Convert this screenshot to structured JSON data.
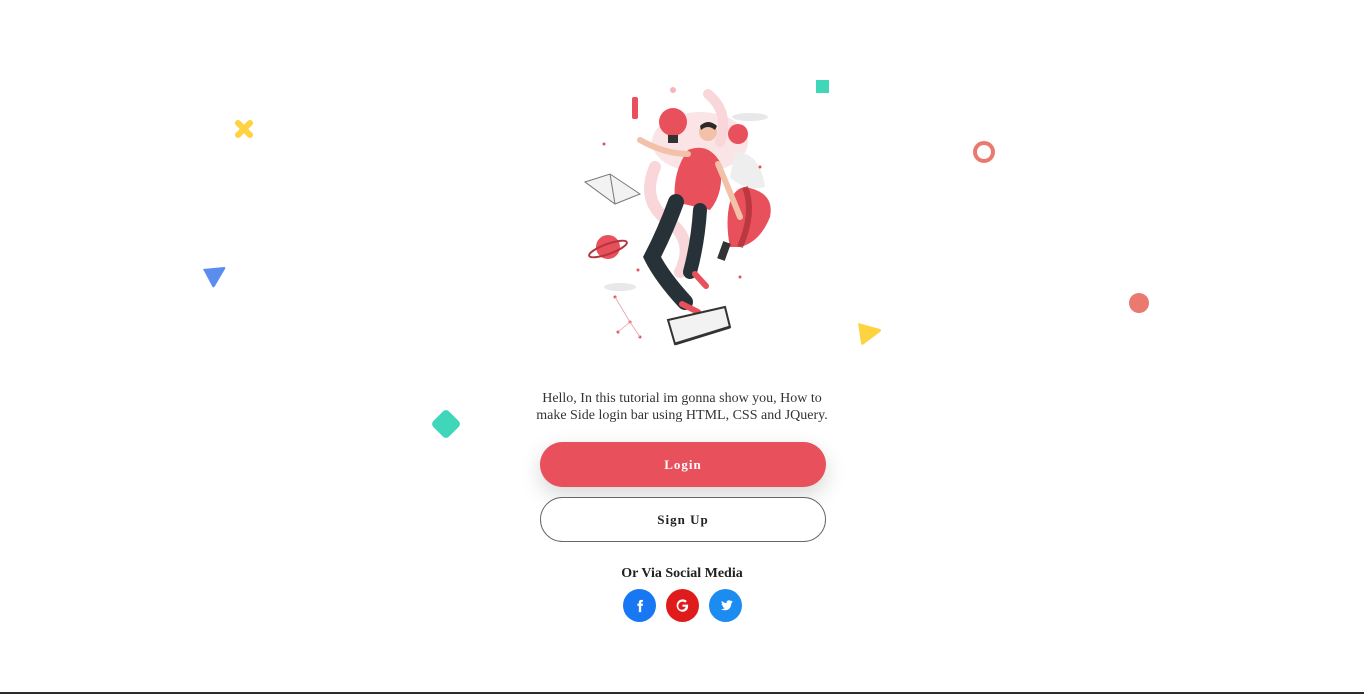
{
  "intro": {
    "text": "Hello, In this tutorial im gonna show you, How to make Side login bar using HTML, CSS and JQuery."
  },
  "buttons": {
    "login_label": "Login",
    "signup_label": "Sign Up"
  },
  "social": {
    "title": "Or Via Social Media",
    "items": [
      {
        "name": "facebook",
        "icon": "facebook-icon",
        "color": "#1877f2"
      },
      {
        "name": "google",
        "icon": "google-icon",
        "color": "#e01b1b"
      },
      {
        "name": "twitter",
        "icon": "twitter-icon",
        "color": "#1d8cf0"
      }
    ]
  },
  "colors": {
    "accent": "#e8505b",
    "teal": "#3fd6b9",
    "coral": "#ea7a70",
    "yellow": "#ffd23f",
    "blue": "#5b8def"
  },
  "decorations": [
    "yellow-cross-icon",
    "teal-square-icon",
    "coral-ring-icon",
    "blue-triangle-icon",
    "coral-dot-icon",
    "yellow-triangle-icon",
    "teal-diamond-icon"
  ]
}
